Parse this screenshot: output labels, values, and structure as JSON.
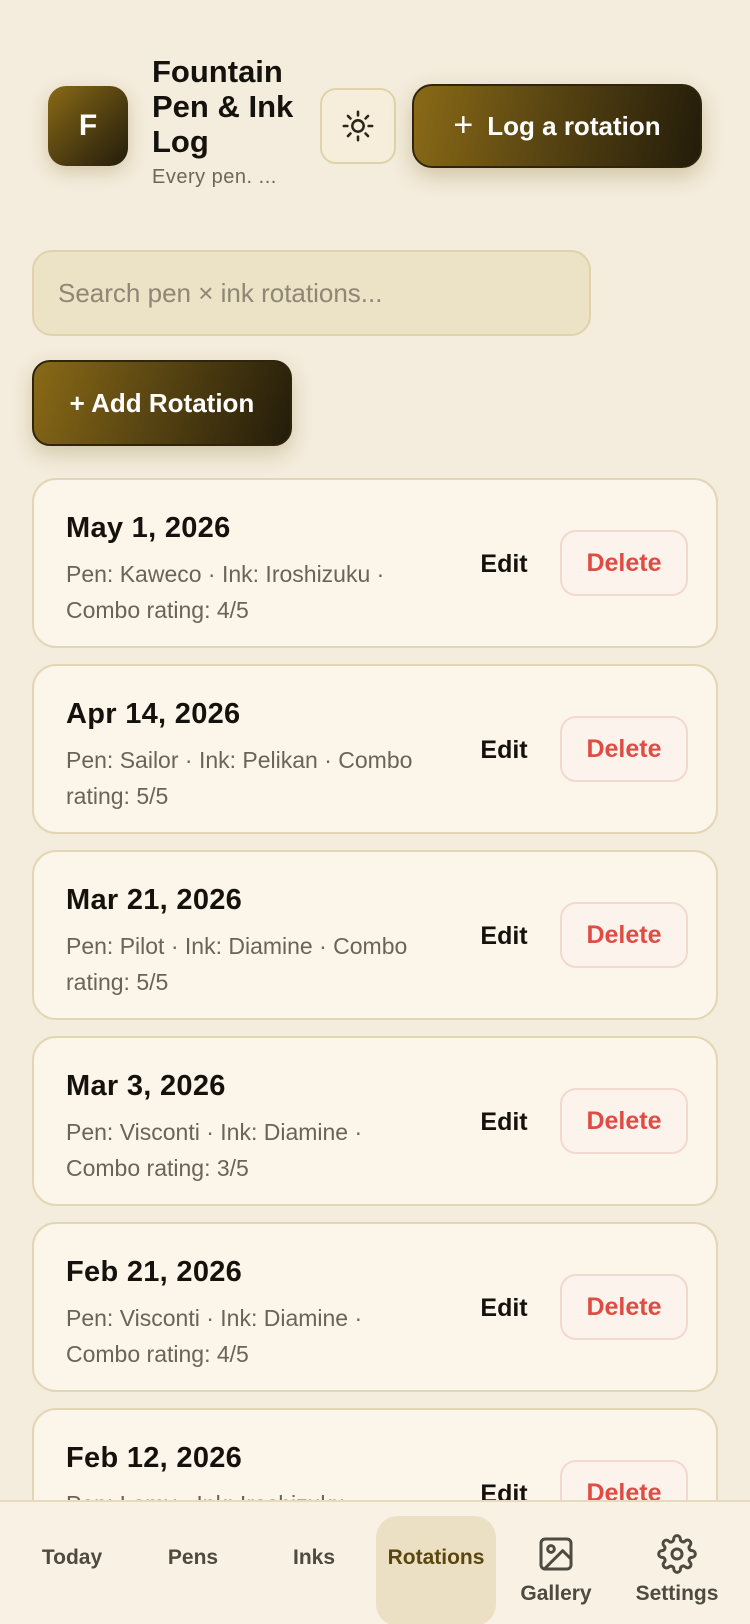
{
  "app": {
    "logo_letter": "F",
    "title": "Fountain Pen & Ink Log",
    "subtitle": "Every pen. ..."
  },
  "header": {
    "theme_toggle_icon": "sun-icon",
    "log_button_label": "Log a rotation"
  },
  "search": {
    "placeholder": "Search pen × ink rotations..."
  },
  "add_button_label": "+ Add Rotation",
  "rotations": [
    {
      "date": "May 1, 2026",
      "details": "Pen: Kaweco · Ink: Iroshizuku · Combo rating: 4/5",
      "edit": "Edit",
      "delete": "Delete"
    },
    {
      "date": "Apr 14, 2026",
      "details": "Pen: Sailor · Ink: Pelikan · Combo rating: 5/5",
      "edit": "Edit",
      "delete": "Delete"
    },
    {
      "date": "Mar 21, 2026",
      "details": "Pen: Pilot · Ink: Diamine · Combo rating: 5/5",
      "edit": "Edit",
      "delete": "Delete"
    },
    {
      "date": "Mar 3, 2026",
      "details": "Pen: Visconti · Ink: Diamine · Combo rating: 3/5",
      "edit": "Edit",
      "delete": "Delete"
    },
    {
      "date": "Feb 21, 2026",
      "details": "Pen: Visconti · Ink: Diamine · Combo rating: 4/5",
      "edit": "Edit",
      "delete": "Delete"
    },
    {
      "date": "Feb 12, 2026",
      "details": "Pen: Lamy · Ink: Iroshizuku ·",
      "edit": "Edit",
      "delete": "Delete"
    }
  ],
  "tabs": [
    {
      "label": "Today",
      "icon": ""
    },
    {
      "label": "Pens",
      "icon": ""
    },
    {
      "label": "Inks",
      "icon": ""
    },
    {
      "label": "Rotations",
      "icon": "",
      "active": true
    },
    {
      "label": "Gallery",
      "icon": "image-icon"
    },
    {
      "label": "Settings",
      "icon": "gear-icon"
    }
  ],
  "colors": {
    "background": "#f4ecdc",
    "accent_gradient_start": "#8a6a16",
    "accent_gradient_end": "#231c0a",
    "delete_text": "#df4c43"
  }
}
